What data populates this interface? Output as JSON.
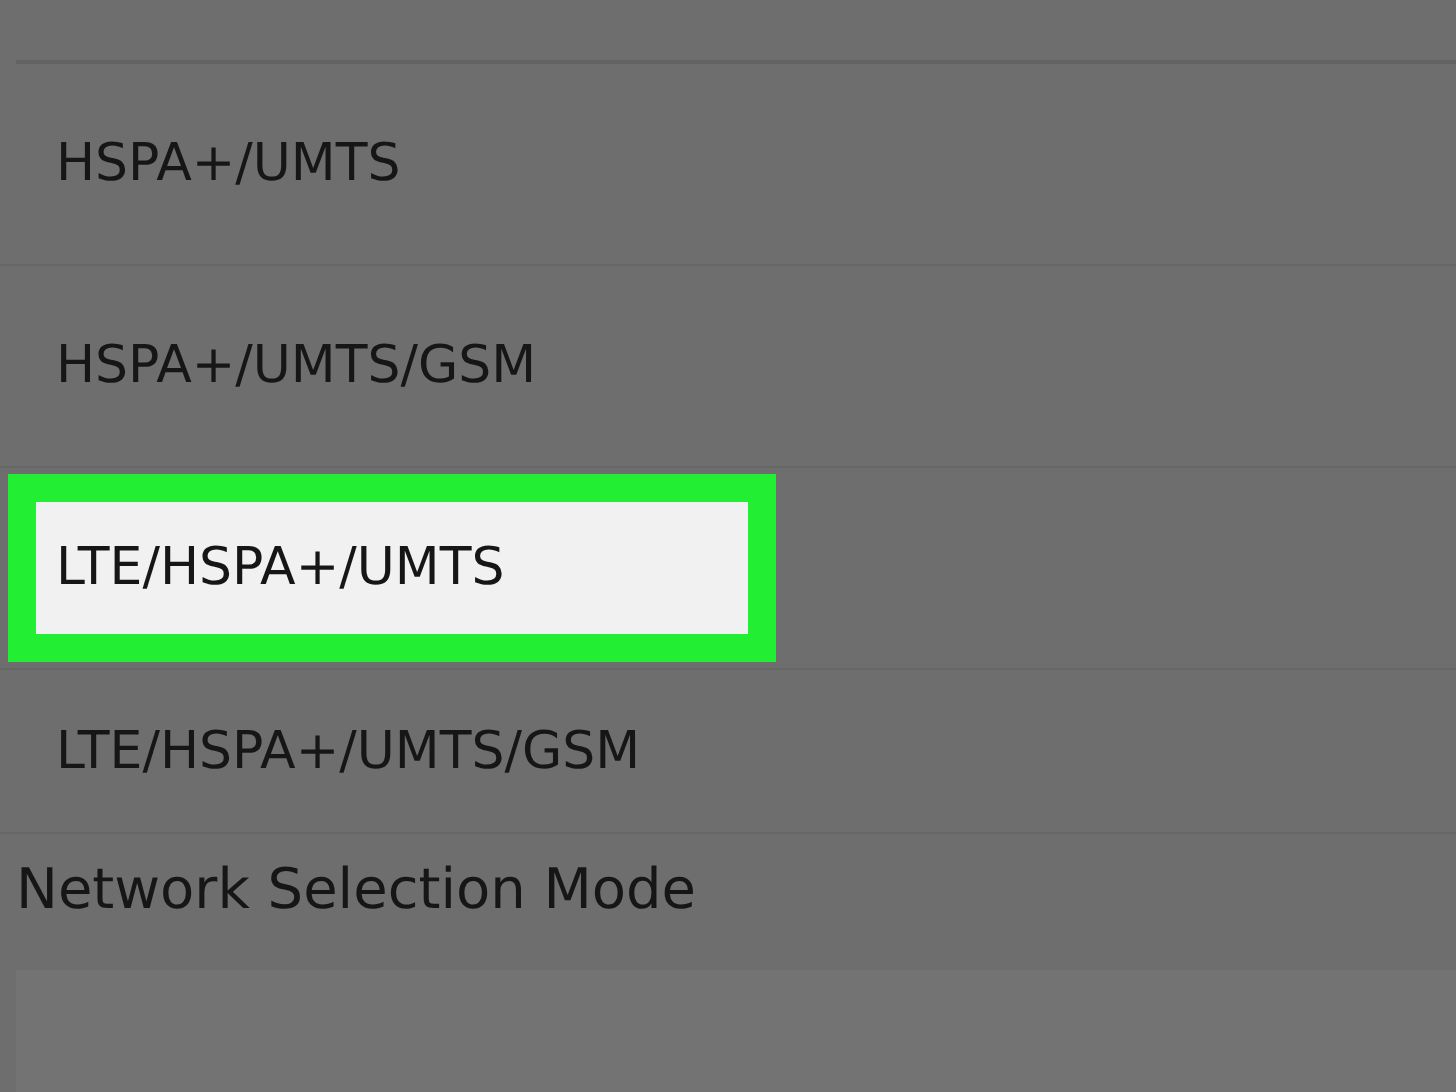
{
  "options": [
    {
      "label": "HSPA+/UMTS",
      "selected": false
    },
    {
      "label": "HSPA+/UMTS/GSM",
      "selected": false
    },
    {
      "label": "LTE/HSPA+/UMTS",
      "selected": true
    },
    {
      "label": "LTE/HSPA+/UMTS/GSM",
      "selected": false
    }
  ],
  "section": {
    "title": "Network Selection Mode"
  }
}
